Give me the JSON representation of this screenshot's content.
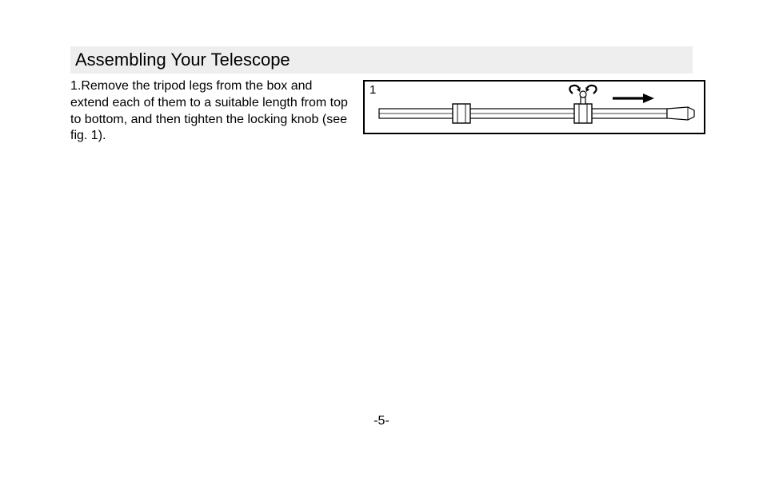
{
  "heading": "Assembling Your Telescope",
  "instruction": "1.Remove the tripod legs from the box and extend each of them to a suitable length from top to bottom, and then tighten the locking knob (see fig. 1).",
  "figure": {
    "label": "1"
  },
  "pageNumber": "-5-"
}
